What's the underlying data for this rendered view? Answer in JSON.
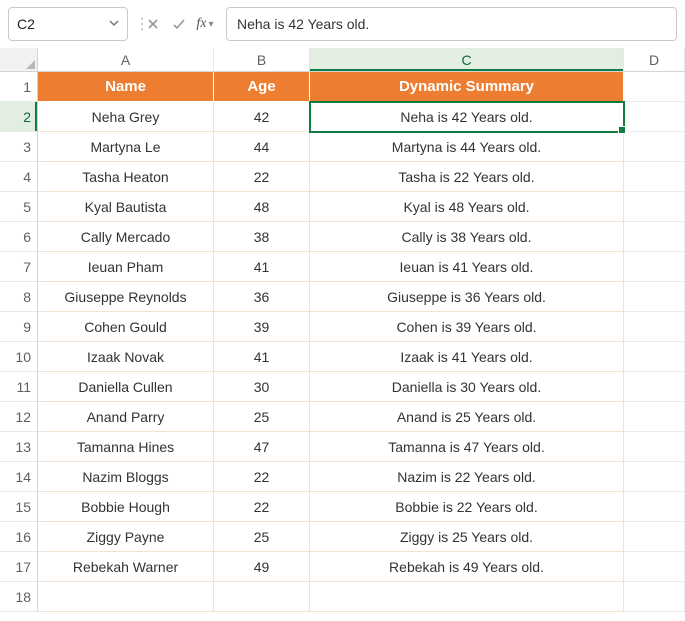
{
  "nameBox": {
    "value": "C2"
  },
  "formulaBar": {
    "value": "Neha is 42 Years old."
  },
  "columns": [
    "A",
    "B",
    "C",
    "D"
  ],
  "activeCol": "C",
  "activeRow": 2,
  "headers": {
    "A": "Name",
    "B": "Age",
    "C": "Dynamic Summary"
  },
  "rows": [
    {
      "n": 1,
      "A": "Name",
      "B": "Age",
      "C": "Dynamic Summary",
      "hdr": true
    },
    {
      "n": 2,
      "A": "Neha Grey",
      "B": "42",
      "C": "Neha is 42 Years old."
    },
    {
      "n": 3,
      "A": "Martyna Le",
      "B": "44",
      "C": "Martyna is 44 Years old."
    },
    {
      "n": 4,
      "A": "Tasha Heaton",
      "B": "22",
      "C": "Tasha is 22 Years old."
    },
    {
      "n": 5,
      "A": "Kyal Bautista",
      "B": "48",
      "C": "Kyal is 48 Years old."
    },
    {
      "n": 6,
      "A": "Cally Mercado",
      "B": "38",
      "C": "Cally is 38 Years old."
    },
    {
      "n": 7,
      "A": "Ieuan Pham",
      "B": "41",
      "C": "Ieuan is 41 Years old."
    },
    {
      "n": 8,
      "A": "Giuseppe Reynolds",
      "B": "36",
      "C": "Giuseppe is 36 Years old."
    },
    {
      "n": 9,
      "A": "Cohen Gould",
      "B": "39",
      "C": "Cohen is 39 Years old."
    },
    {
      "n": 10,
      "A": "Izaak Novak",
      "B": "41",
      "C": "Izaak is 41 Years old."
    },
    {
      "n": 11,
      "A": "Daniella Cullen",
      "B": "30",
      "C": "Daniella is 30 Years old."
    },
    {
      "n": 12,
      "A": "Anand Parry",
      "B": "25",
      "C": "Anand is 25 Years old."
    },
    {
      "n": 13,
      "A": "Tamanna Hines",
      "B": "47",
      "C": "Tamanna is 47 Years old."
    },
    {
      "n": 14,
      "A": "Nazim Bloggs",
      "B": "22",
      "C": "Nazim is 22 Years old."
    },
    {
      "n": 15,
      "A": "Bobbie Hough",
      "B": "22",
      "C": "Bobbie is 22 Years old."
    },
    {
      "n": 16,
      "A": "Ziggy Payne",
      "B": "25",
      "C": "Ziggy is 25 Years old."
    },
    {
      "n": 17,
      "A": "Rebekah Warner",
      "B": "49",
      "C": "Rebekah is 49 Years old."
    },
    {
      "n": 18,
      "A": "",
      "B": "",
      "C": ""
    }
  ],
  "chart_data": {
    "type": "table",
    "title": "Dynamic Summary",
    "columns": [
      "Name",
      "Age",
      "Dynamic Summary"
    ],
    "data": [
      [
        "Neha Grey",
        42,
        "Neha is 42 Years old."
      ],
      [
        "Martyna Le",
        44,
        "Martyna is 44 Years old."
      ],
      [
        "Tasha Heaton",
        22,
        "Tasha is 22 Years old."
      ],
      [
        "Kyal Bautista",
        48,
        "Kyal is 48 Years old."
      ],
      [
        "Cally Mercado",
        38,
        "Cally is 38 Years old."
      ],
      [
        "Ieuan Pham",
        41,
        "Ieuan is 41 Years old."
      ],
      [
        "Giuseppe Reynolds",
        36,
        "Giuseppe is 36 Years old."
      ],
      [
        "Cohen Gould",
        39,
        "Cohen is 39 Years old."
      ],
      [
        "Izaak Novak",
        41,
        "Izaak is 41 Years old."
      ],
      [
        "Daniella Cullen",
        30,
        "Daniella is 30 Years old."
      ],
      [
        "Anand Parry",
        25,
        "Anand is 25 Years old."
      ],
      [
        "Tamanna Hines",
        47,
        "Tamanna is 47 Years old."
      ],
      [
        "Nazim Bloggs",
        22,
        "Nazim is 22 Years old."
      ],
      [
        "Bobbie Hough",
        22,
        "Bobbie is 22 Years old."
      ],
      [
        "Ziggy Payne",
        25,
        "Ziggy is 25 Years old."
      ],
      [
        "Rebekah Warner",
        49,
        "Rebekah is 49 Years old."
      ]
    ]
  }
}
